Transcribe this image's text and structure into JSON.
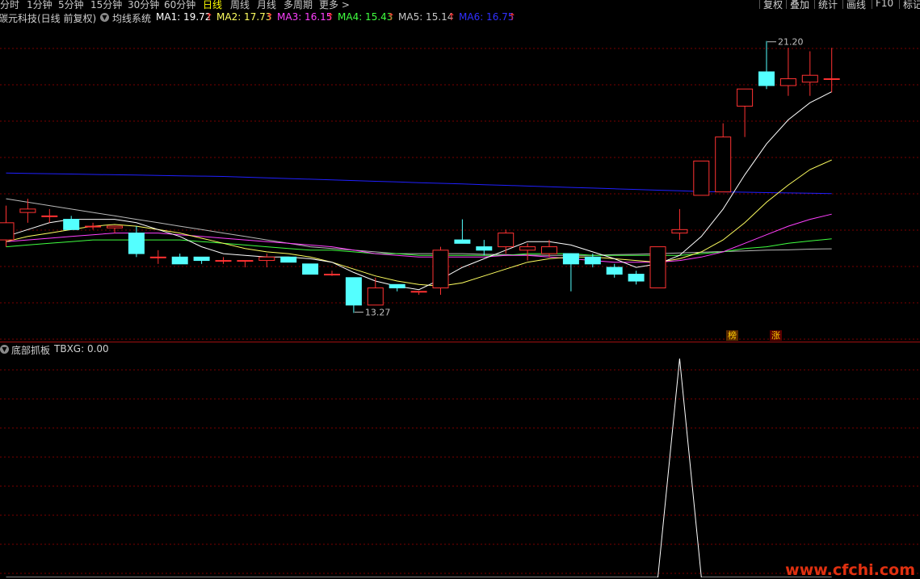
{
  "toolbar": {
    "periods": [
      "分时",
      "1分钟",
      "5分钟",
      "15分钟",
      "30分钟",
      "60分钟",
      "日线",
      "周线",
      "月线",
      "多周期",
      "更多 >"
    ],
    "active_period": "日线",
    "right_buttons": [
      "复权",
      "叠加",
      "统计",
      "画线",
      "F10",
      "标记"
    ]
  },
  "stock": {
    "name": "碳元科技(日线 前复权)",
    "indicator_name": "均线系统"
  },
  "ma_values": [
    {
      "label": "MA1: 19.72",
      "color": "#ffffff"
    },
    {
      "label": "MA2: 17.73",
      "color": "#ffff60"
    },
    {
      "label": "MA3: 16.15",
      "color": "#ff40ff"
    },
    {
      "label": "MA4: 15.43",
      "color": "#40ff40"
    },
    {
      "label": "MA5: 15.14",
      "color": "#c0c0c0"
    },
    {
      "label": "MA6: 16.75",
      "color": "#3030ff"
    }
  ],
  "up_arrow": "↑",
  "annotations": {
    "high_label": "21.20",
    "low_label": "13.27",
    "tag_bang": "榜",
    "tag_zhang": "涨"
  },
  "sub_panel": {
    "indicator_name": "底部抓板",
    "value_label": "TBXG: 0.00"
  },
  "watermark": "www.cfchi.com",
  "colors": {
    "up": "#ff3232",
    "down": "#54ffff",
    "grid": "#7a0000",
    "ma1": "#ffffff",
    "ma2": "#ffff60",
    "ma3": "#ff40ff",
    "ma4": "#40ff40",
    "ma6": "#2020ff"
  },
  "chart_data": {
    "type": "candlestick",
    "price_range": [
      12.6,
      21.5
    ],
    "candles": [
      {
        "o": 15.4,
        "h": 16.4,
        "l": 15.2,
        "c": 15.9
      },
      {
        "o": 16.2,
        "h": 16.6,
        "l": 15.9,
        "c": 16.3
      },
      {
        "o": 16.1,
        "h": 16.3,
        "l": 15.9,
        "c": 16.1
      },
      {
        "o": 16.0,
        "h": 16.1,
        "l": 15.7,
        "c": 15.7
      },
      {
        "o": 15.8,
        "h": 15.9,
        "l": 15.7,
        "c": 15.8
      },
      {
        "o": 15.75,
        "h": 15.8,
        "l": 15.6,
        "c": 15.8
      },
      {
        "o": 15.6,
        "h": 15.8,
        "l": 14.9,
        "c": 15.0
      },
      {
        "o": 14.9,
        "h": 15.1,
        "l": 14.7,
        "c": 14.9
      },
      {
        "o": 14.9,
        "h": 15.0,
        "l": 14.7,
        "c": 14.7
      },
      {
        "o": 14.9,
        "h": 14.9,
        "l": 14.7,
        "c": 14.8
      },
      {
        "o": 14.8,
        "h": 14.9,
        "l": 14.7,
        "c": 14.8
      },
      {
        "o": 14.8,
        "h": 14.8,
        "l": 14.6,
        "c": 14.8
      },
      {
        "o": 14.8,
        "h": 15.0,
        "l": 14.6,
        "c": 14.9
      },
      {
        "o": 14.9,
        "h": 14.9,
        "l": 14.75,
        "c": 14.75
      },
      {
        "o": 14.7,
        "h": 14.7,
        "l": 14.4,
        "c": 14.4
      },
      {
        "o": 14.4,
        "h": 14.5,
        "l": 14.35,
        "c": 14.4
      },
      {
        "o": 14.3,
        "h": 14.3,
        "l": 13.27,
        "c": 13.5
      },
      {
        "o": 13.5,
        "h": 14.3,
        "l": 13.5,
        "c": 14.0
      },
      {
        "o": 14.1,
        "h": 14.1,
        "l": 13.9,
        "c": 14.0
      },
      {
        "o": 13.9,
        "h": 13.9,
        "l": 13.8,
        "c": 13.9
      },
      {
        "o": 14.0,
        "h": 15.2,
        "l": 13.8,
        "c": 15.1
      },
      {
        "o": 15.4,
        "h": 16.0,
        "l": 15.3,
        "c": 15.3
      },
      {
        "o": 15.2,
        "h": 15.4,
        "l": 14.95,
        "c": 15.1
      },
      {
        "o": 15.2,
        "h": 15.7,
        "l": 15.0,
        "c": 15.6
      },
      {
        "o": 15.1,
        "h": 15.3,
        "l": 14.8,
        "c": 15.2
      },
      {
        "o": 15.0,
        "h": 15.4,
        "l": 14.9,
        "c": 15.2
      },
      {
        "o": 15.0,
        "h": 15.0,
        "l": 13.9,
        "c": 14.7
      },
      {
        "o": 14.9,
        "h": 15.0,
        "l": 14.6,
        "c": 14.7
      },
      {
        "o": 14.6,
        "h": 14.7,
        "l": 14.3,
        "c": 14.4
      },
      {
        "o": 14.4,
        "h": 14.5,
        "l": 14.1,
        "c": 14.2
      },
      {
        "o": 14.0,
        "h": 15.2,
        "l": 14.0,
        "c": 15.2
      },
      {
        "o": 15.6,
        "h": 16.3,
        "l": 15.4,
        "c": 15.7
      },
      {
        "o": 16.7,
        "h": 16.7,
        "l": 16.7,
        "c": 17.7
      },
      {
        "o": 16.8,
        "h": 18.8,
        "l": 16.8,
        "c": 18.4
      },
      {
        "o": 19.3,
        "h": 19.3,
        "l": 18.4,
        "c": 19.8
      },
      {
        "o": 20.3,
        "h": 21.2,
        "l": 19.8,
        "c": 19.9
      },
      {
        "o": 19.9,
        "h": 21.0,
        "l": 19.6,
        "c": 20.1
      },
      {
        "o": 20.0,
        "h": 20.9,
        "l": 19.6,
        "c": 20.2
      },
      {
        "o": 20.1,
        "h": 21.0,
        "l": 19.7,
        "c": 20.1
      }
    ],
    "ma1": [
      15.5,
      15.7,
      15.9,
      16.0,
      16.0,
      16.0,
      15.9,
      15.7,
      15.5,
      15.2,
      15.0,
      14.95,
      14.9,
      14.9,
      14.85,
      14.75,
      14.45,
      14.2,
      14.05,
      13.95,
      14.25,
      14.6,
      14.85,
      15.1,
      15.35,
      15.35,
      15.25,
      15.05,
      14.85,
      14.6,
      14.7,
      14.95,
      15.5,
      16.3,
      17.3,
      18.2,
      18.9,
      19.4,
      19.72
    ],
    "ma2": [
      15.35,
      15.5,
      15.6,
      15.7,
      15.8,
      15.85,
      15.8,
      15.7,
      15.6,
      15.45,
      15.3,
      15.15,
      15.05,
      15.0,
      14.9,
      14.75,
      14.55,
      14.35,
      14.2,
      14.1,
      14.05,
      14.15,
      14.35,
      14.55,
      14.75,
      14.85,
      14.9,
      14.9,
      14.85,
      14.8,
      14.75,
      14.85,
      15.05,
      15.4,
      15.9,
      16.5,
      17.0,
      17.45,
      17.73
    ],
    "ma3": [
      15.35,
      15.4,
      15.45,
      15.5,
      15.55,
      15.6,
      15.6,
      15.6,
      15.55,
      15.5,
      15.45,
      15.4,
      15.35,
      15.3,
      15.25,
      15.2,
      15.1,
      15.0,
      14.95,
      14.9,
      14.9,
      14.9,
      14.9,
      14.95,
      14.95,
      14.9,
      14.85,
      14.8,
      14.75,
      14.75,
      14.75,
      14.8,
      14.9,
      15.05,
      15.3,
      15.55,
      15.8,
      16.0,
      16.15
    ],
    "ma4": [
      15.2,
      15.25,
      15.3,
      15.35,
      15.4,
      15.4,
      15.4,
      15.4,
      15.4,
      15.35,
      15.3,
      15.25,
      15.2,
      15.15,
      15.1,
      15.1,
      15.05,
      15.0,
      15.0,
      14.95,
      14.95,
      14.95,
      14.95,
      14.95,
      15.0,
      15.0,
      15.0,
      14.95,
      14.95,
      14.95,
      14.95,
      14.95,
      15.0,
      15.05,
      15.15,
      15.2,
      15.3,
      15.37,
      15.43
    ],
    "ma5": [
      16.6,
      16.5,
      16.4,
      16.3,
      16.2,
      16.1,
      16.0,
      15.9,
      15.8,
      15.7,
      15.6,
      15.5,
      15.4,
      15.3,
      15.2,
      15.15,
      15.1,
      15.05,
      15.0,
      15.0,
      15.0,
      15.0,
      14.98,
      14.97,
      14.96,
      14.95,
      14.95,
      14.95,
      14.97,
      14.98,
      15.0,
      15.02,
      15.04,
      15.06,
      15.08,
      15.1,
      15.11,
      15.13,
      15.14
    ],
    "ma6": [
      17.35,
      17.34,
      17.33,
      17.32,
      17.31,
      17.3,
      17.29,
      17.28,
      17.27,
      17.26,
      17.25,
      17.23,
      17.21,
      17.19,
      17.17,
      17.15,
      17.13,
      17.11,
      17.09,
      17.07,
      17.05,
      17.03,
      17.01,
      16.99,
      16.97,
      16.95,
      16.93,
      16.91,
      16.89,
      16.87,
      16.85,
      16.83,
      16.81,
      16.8,
      16.79,
      16.78,
      16.77,
      16.76,
      16.75
    ],
    "sub_indicator": {
      "name": "TBXG",
      "range": [
        0,
        1
      ],
      "values": [
        0,
        0,
        0,
        0,
        0,
        0,
        0,
        0,
        0,
        0,
        0,
        0,
        0,
        0,
        0,
        0,
        0,
        0,
        0,
        0,
        0,
        0,
        0,
        0,
        0,
        0,
        0,
        0,
        0,
        0,
        0,
        1,
        0,
        0,
        0,
        0,
        0,
        0,
        0
      ]
    }
  }
}
